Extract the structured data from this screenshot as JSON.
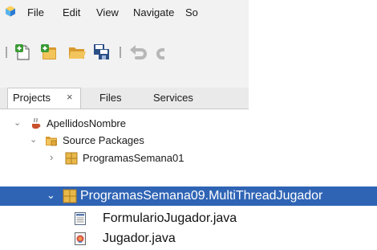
{
  "menu": {
    "items": [
      "File",
      "Edit",
      "View",
      "Navigate",
      "So"
    ],
    "logo_icon": "netbeans-cube-icon"
  },
  "toolbar": {
    "buttons": [
      "new-file-icon",
      "new-project-icon",
      "open-project-icon",
      "save-all-icon",
      "undo-icon",
      "redo-icon"
    ]
  },
  "tabs": {
    "items": [
      "Projects",
      "Files",
      "Services"
    ],
    "active": "Projects",
    "close_glyph": "×"
  },
  "tree": {
    "project": "ApellidosNombre",
    "source_packages": "Source Packages",
    "package_1": "ProgramasSemana01"
  },
  "detail": {
    "selected_package": "ProgramasSemana09.MultiThreadJugador",
    "files": [
      "FormularioJugador.java",
      "Jugador.java"
    ]
  },
  "colors": {
    "selection": "#2f64b5",
    "package_icon": "#e8b84a",
    "panel_bg": "#f2f2f2"
  }
}
